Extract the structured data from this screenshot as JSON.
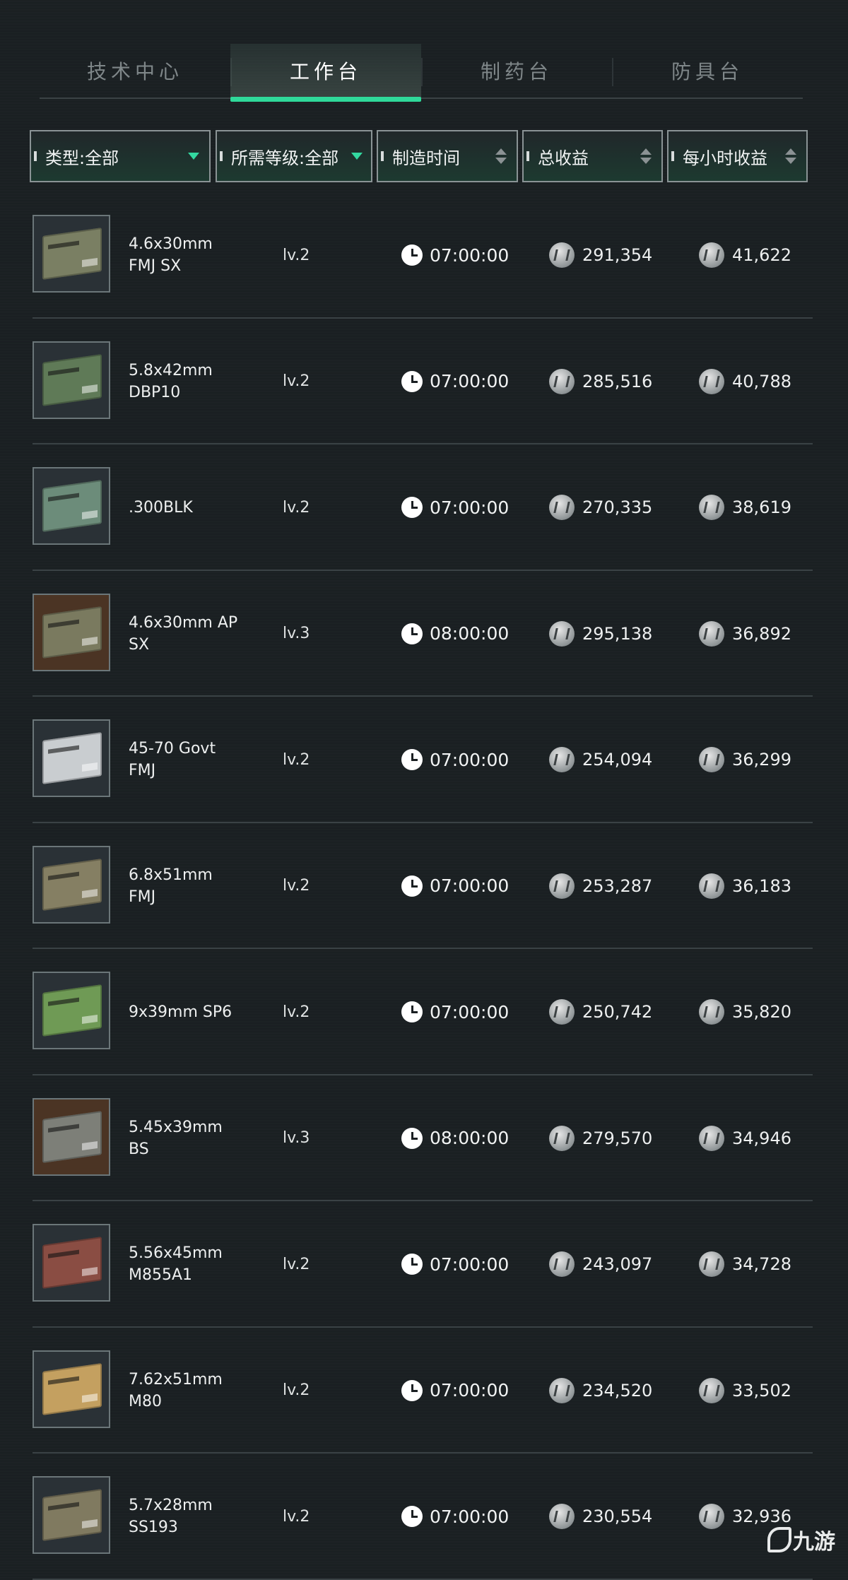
{
  "tabs": [
    {
      "label": "技术中心",
      "active": false
    },
    {
      "label": "工作台",
      "active": true
    },
    {
      "label": "制药台",
      "active": false
    },
    {
      "label": "防具台",
      "active": false
    }
  ],
  "filters": {
    "type": "类型:全部",
    "level": "所需等级:全部",
    "time": "制造时间",
    "total": "总收益",
    "hourly": "每小时收益"
  },
  "items": [
    {
      "name": "4.6x30mm\nFMJ SX",
      "level": "lv.2",
      "time": "07:00:00",
      "total": "291,354",
      "hourly": "41,622",
      "box_color": "#7a7f63",
      "bg": "dark"
    },
    {
      "name": "5.8x42mm\nDBP10",
      "level": "lv.2",
      "time": "07:00:00",
      "total": "285,516",
      "hourly": "40,788",
      "box_color": "#5f7a57",
      "bg": "dark"
    },
    {
      "name": ".300BLK",
      "level": "lv.2",
      "time": "07:00:00",
      "total": "270,335",
      "hourly": "38,619",
      "box_color": "#6c8c7a",
      "bg": "dark"
    },
    {
      "name": "4.6x30mm AP\nSX",
      "level": "lv.3",
      "time": "08:00:00",
      "total": "295,138",
      "hourly": "36,892",
      "box_color": "#7a7a5f",
      "bg": "brown"
    },
    {
      "name": "45-70 Govt\nFMJ",
      "level": "lv.2",
      "time": "07:00:00",
      "total": "254,094",
      "hourly": "36,299",
      "box_color": "#c9cdd0",
      "bg": "dark"
    },
    {
      "name": "6.8x51mm\nFMJ",
      "level": "lv.2",
      "time": "07:00:00",
      "total": "253,287",
      "hourly": "36,183",
      "box_color": "#857f63",
      "bg": "dark"
    },
    {
      "name": "9x39mm SP6",
      "level": "lv.2",
      "time": "07:00:00",
      "total": "250,742",
      "hourly": "35,820",
      "box_color": "#6f9a55",
      "bg": "dark"
    },
    {
      "name": "5.45x39mm\nBS",
      "level": "lv.3",
      "time": "08:00:00",
      "total": "279,570",
      "hourly": "34,946",
      "box_color": "#7d7f78",
      "bg": "brown"
    },
    {
      "name": "5.56x45mm\nM855A1",
      "level": "lv.2",
      "time": "07:00:00",
      "total": "243,097",
      "hourly": "34,728",
      "box_color": "#8a4d43",
      "bg": "dark"
    },
    {
      "name": "7.62x51mm\nM80",
      "level": "lv.2",
      "time": "07:00:00",
      "total": "234,520",
      "hourly": "33,502",
      "box_color": "#c4a060",
      "bg": "dark"
    },
    {
      "name": "5.7x28mm\nSS193",
      "level": "lv.2",
      "time": "07:00:00",
      "total": "230,554",
      "hourly": "32,936",
      "box_color": "#807a60",
      "bg": "dark"
    }
  ],
  "watermark": "九游",
  "colors": {
    "accent": "#2fd99a",
    "background": "#1a1f22",
    "divider": "#3a4245"
  }
}
